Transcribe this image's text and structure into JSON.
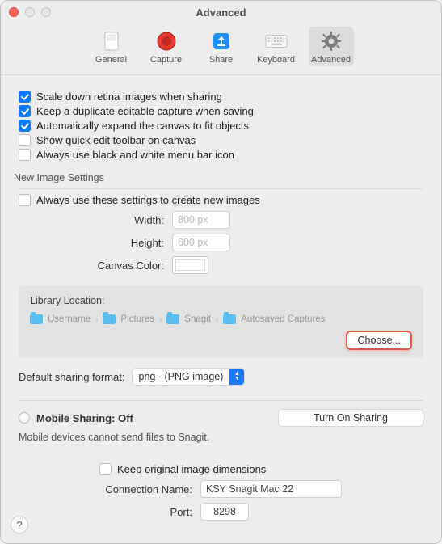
{
  "window": {
    "title": "Advanced"
  },
  "toolbar": {
    "items": [
      {
        "label": "General"
      },
      {
        "label": "Capture"
      },
      {
        "label": "Share"
      },
      {
        "label": "Keyboard"
      },
      {
        "label": "Advanced"
      }
    ]
  },
  "checks": {
    "scale_down": "Scale down retina images when sharing",
    "keep_duplicate": "Keep a duplicate editable capture when saving",
    "auto_expand": "Automatically expand the canvas to fit objects",
    "quick_edit": "Show quick edit toolbar on canvas",
    "bw_menubar": "Always use black and white menu bar icon"
  },
  "new_image": {
    "section": "New Image Settings",
    "always_use": "Always use these settings to create new images",
    "width_label": "Width:",
    "width_placeholder": "800 px",
    "height_label": "Height:",
    "height_placeholder": "600 px",
    "canvas_color_label": "Canvas Color:"
  },
  "library": {
    "title": "Library Location:",
    "crumbs": [
      "Username",
      "Pictures",
      "Snagit",
      "Autosaved Captures"
    ],
    "choose": "Choose..."
  },
  "default_format": {
    "label": "Default sharing format:",
    "value": "png - (PNG image)"
  },
  "mobile": {
    "title": "Mobile Sharing: Off",
    "turn_on": "Turn On Sharing",
    "note": "Mobile devices cannot send files to Snagit.",
    "keep_original": "Keep original image dimensions",
    "connection_label": "Connection Name:",
    "connection_value": "KSY Snagit Mac 22",
    "port_label": "Port:",
    "port_value": "8298"
  },
  "help": "?"
}
